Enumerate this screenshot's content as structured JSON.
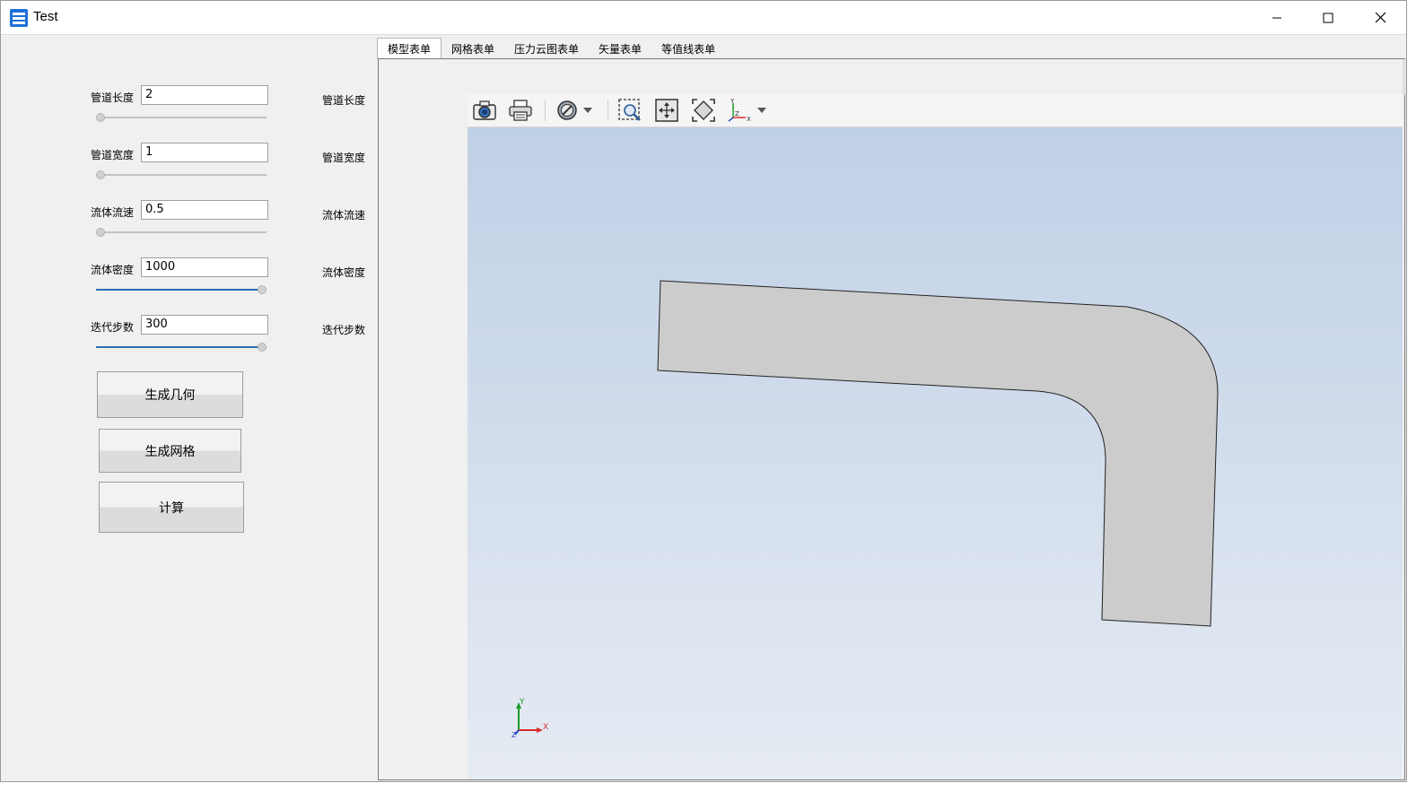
{
  "window": {
    "title": "Test"
  },
  "params": [
    {
      "label": "管道长度",
      "value": "2",
      "side_label": "管道长度",
      "slider_level": 0.0
    },
    {
      "label": "管道宽度",
      "value": "1",
      "side_label": "管道宽度",
      "slider_level": 0.0
    },
    {
      "label": "流体流速",
      "value": "0.5",
      "side_label": "流体流速",
      "slider_level": 0.0
    },
    {
      "label": "流体密度",
      "value": "1000",
      "side_label": "流体密度",
      "slider_level": 1.0
    },
    {
      "label": "迭代步数",
      "value": "300",
      "side_label": "迭代步数",
      "slider_level": 1.0
    }
  ],
  "buttons": {
    "generate_geometry": "生成几何",
    "generate_mesh": "生成网格",
    "compute": "计算"
  },
  "tabs": [
    {
      "label": "模型表单",
      "active": true
    },
    {
      "label": "网格表单",
      "active": false
    },
    {
      "label": "压力云图表单",
      "active": false
    },
    {
      "label": "矢量表单",
      "active": false
    },
    {
      "label": "等值线表单",
      "active": false
    }
  ],
  "toolbar_icons": [
    "camera-icon",
    "print-icon",
    "no-sign-icon",
    "dropdown-arrow-icon",
    "zoom-box-icon",
    "fit-all-icon",
    "reset-view-icon",
    "axes-icon",
    "dropdown-arrow-icon"
  ],
  "axes": {
    "x": "X",
    "y": "Y",
    "z": "Z",
    "toolbar_x": "X",
    "toolbar_y": "Y",
    "toolbar_z": "Z"
  },
  "colors": {
    "accent": "#2b6cb0",
    "shape_fill": "#cccccc",
    "viewport_top": "#bfd0e6",
    "viewport_bottom": "#e6ebf3"
  }
}
